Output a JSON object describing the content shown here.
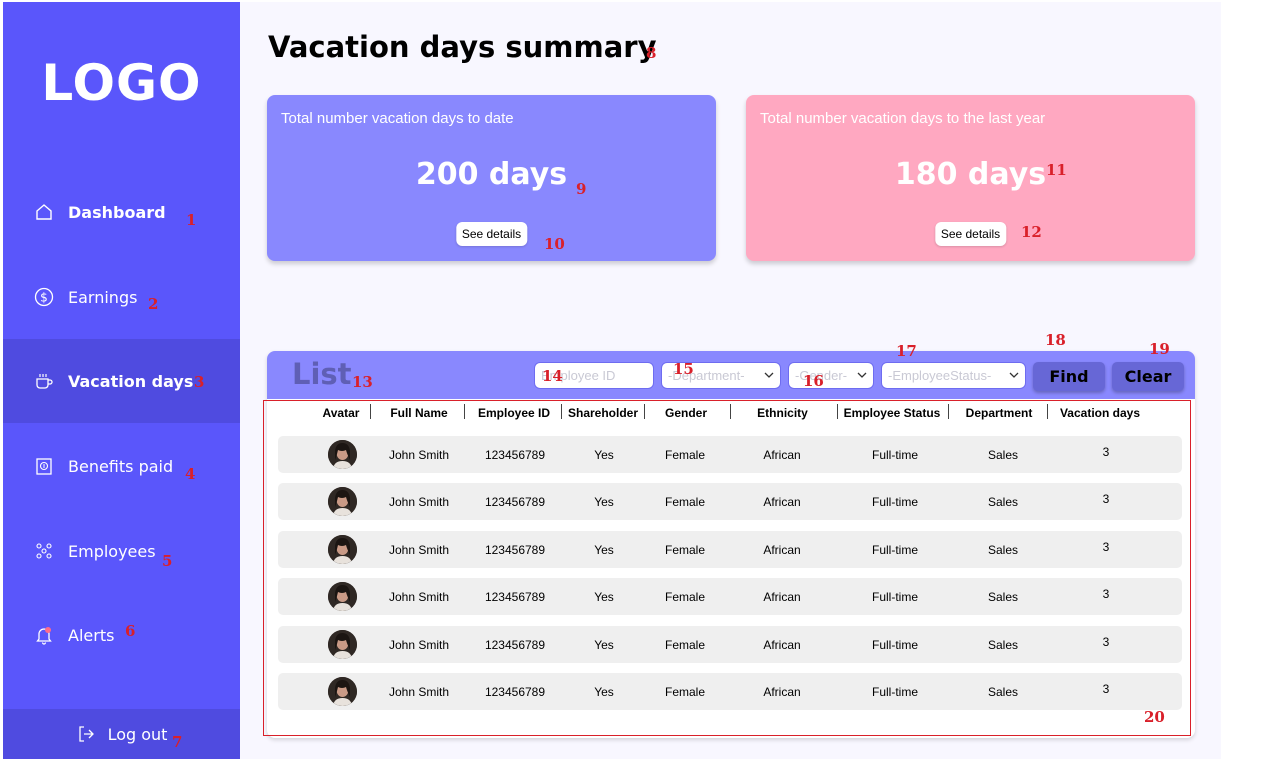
{
  "sidebar": {
    "logo": "LOGO",
    "items": [
      {
        "label": "Dashboard",
        "icon": "home-icon",
        "marker": "1"
      },
      {
        "label": "Earnings",
        "icon": "dollar-icon",
        "marker": "2"
      },
      {
        "label": "Vacation days",
        "icon": "cup-icon",
        "marker": "3"
      },
      {
        "label": "Benefits paid",
        "icon": "benefits-icon",
        "marker": "4"
      },
      {
        "label": "Employees",
        "icon": "people-icon",
        "marker": "5"
      },
      {
        "label": "Alerts",
        "icon": "bell-icon",
        "marker": "6"
      }
    ],
    "logout": {
      "label": "Log out",
      "icon": "logout-icon",
      "marker": "7"
    }
  },
  "page": {
    "title": "Vacation days summary",
    "title_marker": "8"
  },
  "cards": [
    {
      "label": "Total number vacation days to date",
      "value": "200 days",
      "button": "See details",
      "value_marker": "9",
      "button_marker": "10"
    },
    {
      "label": "Total number vacation days to the last year",
      "value": "180 days",
      "button": "See details",
      "value_marker": "11",
      "button_marker": "12"
    }
  ],
  "list": {
    "title": "List",
    "title_marker": "13",
    "filters": {
      "employee_id_placeholder": "Employee ID",
      "department": "-Department-",
      "gender": "-Gender-",
      "employee_status": "-EmployeeStatus-"
    },
    "filter_markers": {
      "employee_id": "14",
      "department": "15",
      "gender": "16",
      "employee_status": "17"
    },
    "find": "Find",
    "clear": "Clear",
    "find_marker": "18",
    "clear_marker": "19",
    "table_marker": "20",
    "columns": [
      "Avatar",
      "Full Name",
      "Employee ID",
      "Shareholder",
      "Gender",
      "Ethnicity",
      "Employee Status",
      "Department",
      "Vacation days"
    ],
    "rows": [
      {
        "name": "John Smith",
        "id": "123456789",
        "shareholder": "Yes",
        "gender": "Female",
        "ethnicity": "African",
        "status": "Full-time",
        "department": "Sales",
        "days": "3"
      },
      {
        "name": "John Smith",
        "id": "123456789",
        "shareholder": "Yes",
        "gender": "Female",
        "ethnicity": "African",
        "status": "Full-time",
        "department": "Sales",
        "days": "3"
      },
      {
        "name": "John Smith",
        "id": "123456789",
        "shareholder": "Yes",
        "gender": "Female",
        "ethnicity": "African",
        "status": "Full-time",
        "department": "Sales",
        "days": "3"
      },
      {
        "name": "John Smith",
        "id": "123456789",
        "shareholder": "Yes",
        "gender": "Female",
        "ethnicity": "African",
        "status": "Full-time",
        "department": "Sales",
        "days": "3"
      },
      {
        "name": "John Smith",
        "id": "123456789",
        "shareholder": "Yes",
        "gender": "Female",
        "ethnicity": "African",
        "status": "Full-time",
        "department": "Sales",
        "days": "3"
      },
      {
        "name": "John Smith",
        "id": "123456789",
        "shareholder": "Yes",
        "gender": "Female",
        "ethnicity": "African",
        "status": "Full-time",
        "department": "Sales",
        "days": "3"
      }
    ]
  },
  "colors": {
    "sidebar": "#5a56fb",
    "card_blue": "#8988fe",
    "card_pink": "#ffa8c1",
    "marker": "#d9202a"
  }
}
